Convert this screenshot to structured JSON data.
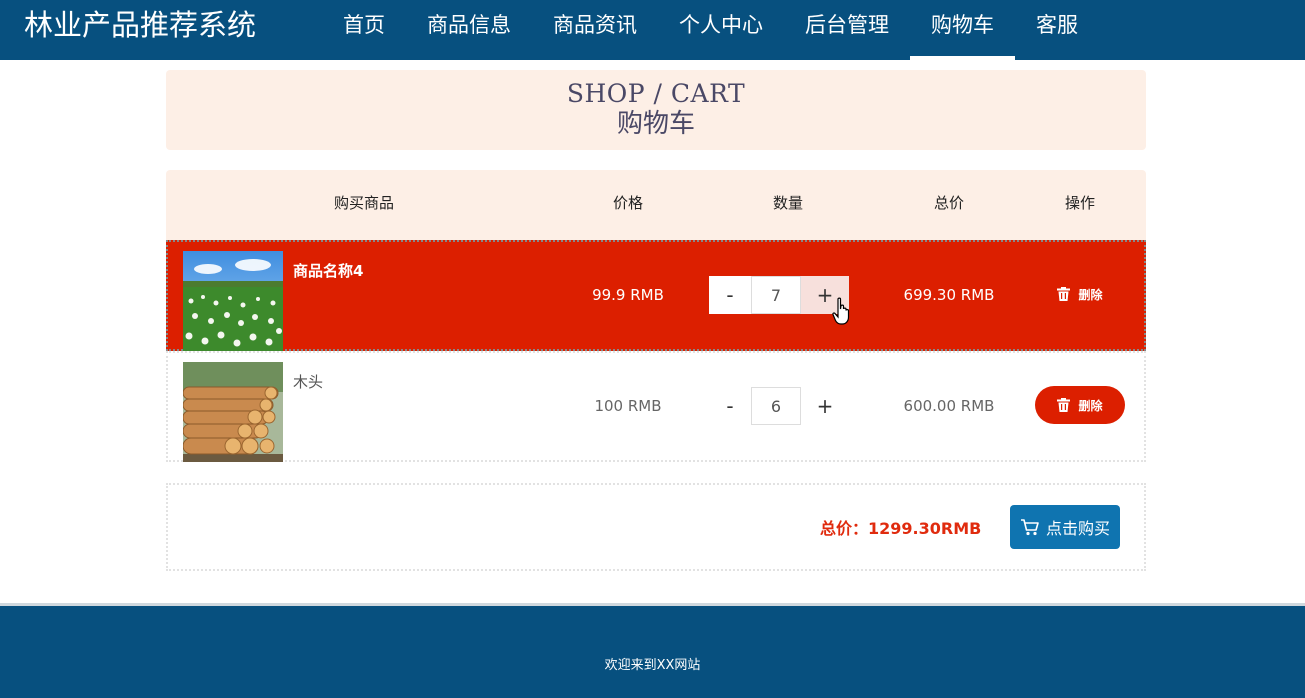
{
  "header": {
    "logo": "林业产品推荐系统",
    "nav": [
      {
        "label": "首页"
      },
      {
        "label": "商品信息"
      },
      {
        "label": "商品资讯"
      },
      {
        "label": "个人中心"
      },
      {
        "label": "后台管理"
      },
      {
        "label": "购物车",
        "active": true
      },
      {
        "label": "客服"
      }
    ]
  },
  "banner": {
    "title_en": "SHOP / CART",
    "title_cn": "购物车"
  },
  "table": {
    "columns": [
      "购买商品",
      "价格",
      "数量",
      "总价",
      "操作"
    ],
    "rows": [
      {
        "name": "商品名称4",
        "price": "99.9 RMB",
        "qty_minus": "-",
        "qty": "7",
        "qty_plus": "+",
        "total": "699.30 RMB",
        "delete": "删除",
        "image": "crop-field-photo",
        "highlighted": true
      },
      {
        "name": "木头",
        "price": "100 RMB",
        "qty_minus": "-",
        "qty": "6",
        "qty_plus": "+",
        "total": "600.00 RMB",
        "delete": "删除",
        "image": "log-pile-photo",
        "highlighted": false
      }
    ]
  },
  "summary": {
    "total": "总价：1299.30RMB",
    "buy_label": "点击购买",
    "buy_icon": "cart-icon"
  },
  "footer": {
    "welcome": "欢迎来到XX网站"
  },
  "colors": {
    "primary": "#07507f",
    "accent_red": "#dc1f00",
    "buy_blue": "#0f74b0",
    "banner_bg": "#fdefe6"
  }
}
